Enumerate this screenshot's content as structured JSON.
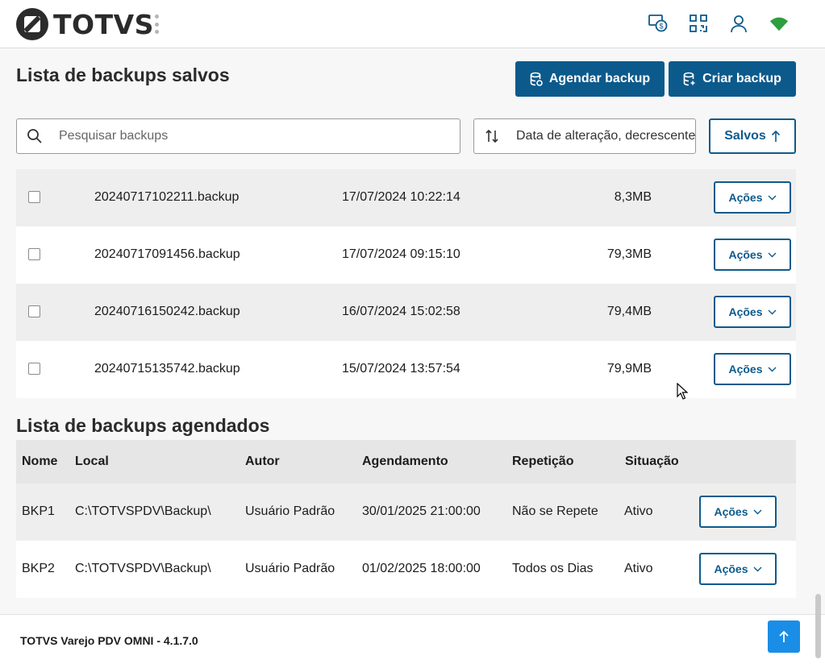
{
  "header": {
    "logo_text": "TOTVS",
    "icons": [
      "money-exchange-icon",
      "qr-code-icon",
      "user-icon",
      "wifi-icon"
    ]
  },
  "saved": {
    "title": "Lista de backups salvos",
    "schedule_button": "Agendar backup",
    "create_button": "Criar backup",
    "search_placeholder": "Pesquisar backups",
    "sort_value": "Data de alteração, decrescente",
    "filter_button": "Salvos",
    "rows": [
      {
        "name": "20240717102211.backup",
        "date": "17/07/2024 10:22:14",
        "size": "8,3MB",
        "action": "Ações"
      },
      {
        "name": "20240717091456.backup",
        "date": "17/07/2024 09:15:10",
        "size": "79,3MB",
        "action": "Ações"
      },
      {
        "name": "20240716150242.backup",
        "date": "16/07/2024 15:02:58",
        "size": "79,4MB",
        "action": "Ações"
      },
      {
        "name": "20240715135742.backup",
        "date": "15/07/2024 13:57:54",
        "size": "79,9MB",
        "action": "Ações"
      }
    ]
  },
  "scheduled": {
    "title": "Lista de backups agendados",
    "columns": [
      "Nome",
      "Local",
      "Autor",
      "Agendamento",
      "Repetição",
      "Situação"
    ],
    "rows": [
      {
        "nome": "BKP1",
        "local": "C:\\TOTVSPDV\\Backup\\",
        "autor": "Usuário Padrão",
        "agendamento": "30/01/2025 21:00:00",
        "repeticao": "Não se Repete",
        "situacao": "Ativo",
        "action": "Ações"
      },
      {
        "nome": "BKP2",
        "local": "C:\\TOTVSPDV\\Backup\\",
        "autor": "Usuário Padrão",
        "agendamento": "01/02/2025 18:00:00",
        "repeticao": "Todos os Dias",
        "situacao": "Ativo",
        "action": "Ações"
      }
    ]
  },
  "footer": {
    "version_text": "TOTVS Varejo PDV OMNI - 4.1.7.0"
  },
  "colors": {
    "primary": "#0c5a8c",
    "accent": "#1a8ee6",
    "wifi": "#2e9e3e"
  }
}
